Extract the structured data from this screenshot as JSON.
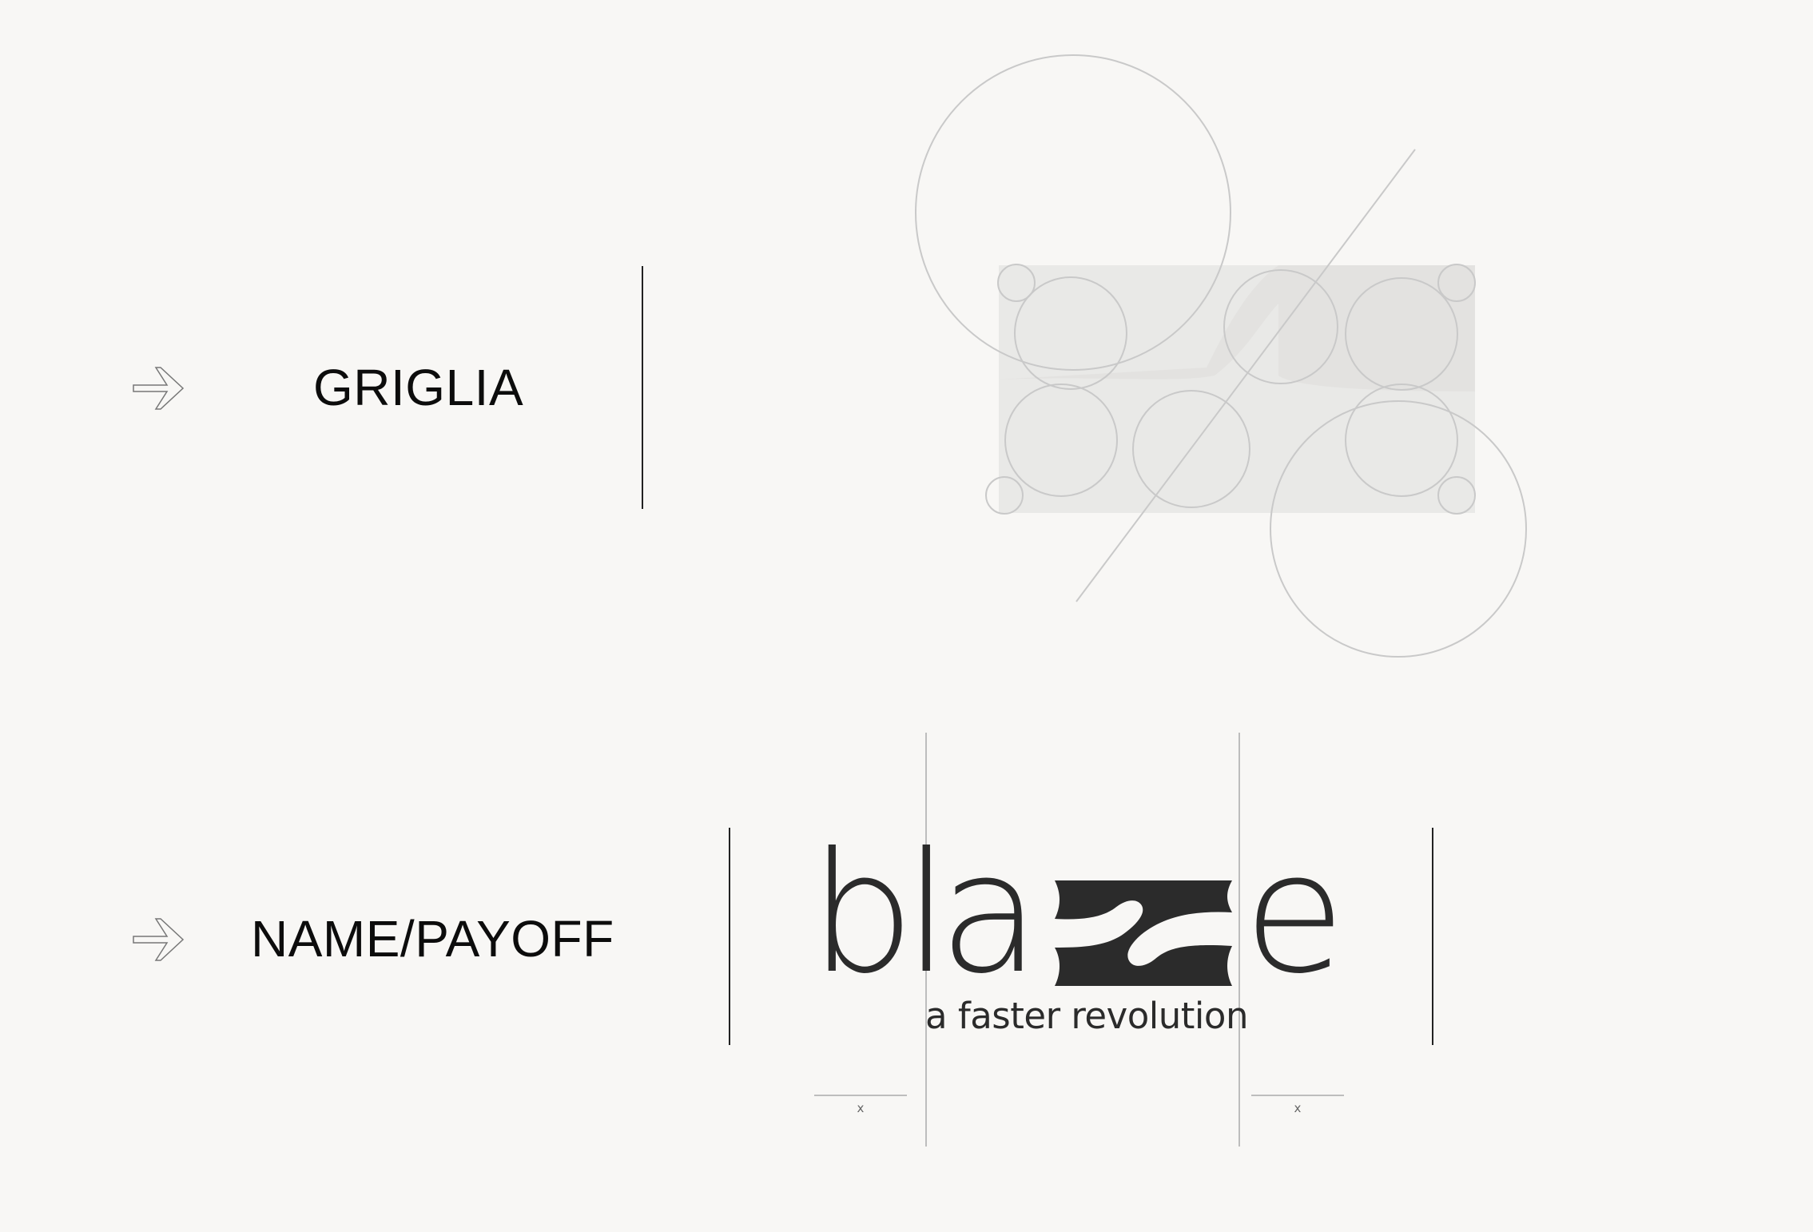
{
  "sections": {
    "grid": {
      "label": "GRIGLIA"
    },
    "name": {
      "label": "NAME/PAYOFF"
    }
  },
  "logo": {
    "letters_left": "bla",
    "letters_right": "e",
    "payoff": "a faster revolution",
    "unit_mark_left": "x",
    "unit_mark_right": "x"
  },
  "colors": {
    "background": "#f8f7f5",
    "text": "#0c0c0c",
    "logo": "#2b2b2b",
    "guide": "#bdbdbd",
    "grid_fill": "#e9e9e7"
  },
  "icons": [
    "arrow-right-icon",
    "arrow-right-icon",
    "construction-grid-graphic",
    "z-monogram-icon"
  ]
}
